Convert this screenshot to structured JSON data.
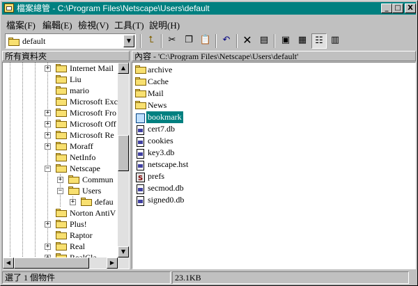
{
  "window": {
    "title": "檔案總管 - C:\\Program Files\\Netscape\\Users\\default"
  },
  "title_buttons": {
    "minimize": "_",
    "maximize": "□",
    "close": "X"
  },
  "menu": [
    {
      "label": "檔案(F)"
    },
    {
      "label": "編輯(E)"
    },
    {
      "label": "檢視(V)"
    },
    {
      "label": "工具(T)"
    },
    {
      "label": "說明(H)"
    }
  ],
  "address": {
    "value": "default"
  },
  "toolbar_icons": [
    "up-folder-icon",
    "cut-icon",
    "copy-icon",
    "paste-icon",
    "undo-icon",
    "delete-icon",
    "properties-icon",
    "large-icons-view-icon",
    "small-icons-view-icon",
    "list-view-icon",
    "details-view-icon"
  ],
  "left_header": "所有資料夾",
  "right_header": "內容 - 'C:\\Program Files\\Netscape\\Users\\default'",
  "tree": [
    {
      "label": "Internet Mail",
      "expander": "+"
    },
    {
      "label": "Liu",
      "expander": ""
    },
    {
      "label": "mario",
      "expander": ""
    },
    {
      "label": "Microsoft Exc",
      "expander": ""
    },
    {
      "label": "Microsoft Fro",
      "expander": "+"
    },
    {
      "label": "Microsoft Off",
      "expander": "+"
    },
    {
      "label": "Microsoft Re",
      "expander": "+"
    },
    {
      "label": "Moraff",
      "expander": "+"
    },
    {
      "label": "NetInfo",
      "expander": ""
    },
    {
      "label": "Netscape",
      "expander": "−"
    },
    {
      "label": "Commun",
      "expander": "+"
    },
    {
      "label": "Users",
      "expander": "−"
    },
    {
      "label": "defau",
      "expander": "+"
    },
    {
      "label": "Norton AntiV",
      "expander": ""
    },
    {
      "label": "Plus!",
      "expander": "+"
    },
    {
      "label": "Raptor",
      "expander": ""
    },
    {
      "label": "Real",
      "expander": "+"
    },
    {
      "label": "RealCla",
      "expander": "+"
    }
  ],
  "files": [
    {
      "name": "archive",
      "kind": "folder"
    },
    {
      "name": "Cache",
      "kind": "folder"
    },
    {
      "name": "Mail",
      "kind": "folder"
    },
    {
      "name": "News",
      "kind": "folder"
    },
    {
      "name": "bookmark",
      "kind": "bookmark",
      "selected": true
    },
    {
      "name": "cert7.db",
      "kind": "file"
    },
    {
      "name": "cookies",
      "kind": "file"
    },
    {
      "name": "key3.db",
      "kind": "file"
    },
    {
      "name": "netscape.hst",
      "kind": "file"
    },
    {
      "name": "prefs",
      "kind": "exe"
    },
    {
      "name": "secmod.db",
      "kind": "file"
    },
    {
      "name": "signed0.db",
      "kind": "file"
    }
  ],
  "status": {
    "selection": "選了 1 個物件",
    "size": "23.1KB"
  },
  "colors": {
    "title_bar": "#008080",
    "selection": "#008080",
    "folder": "#f8e070"
  }
}
